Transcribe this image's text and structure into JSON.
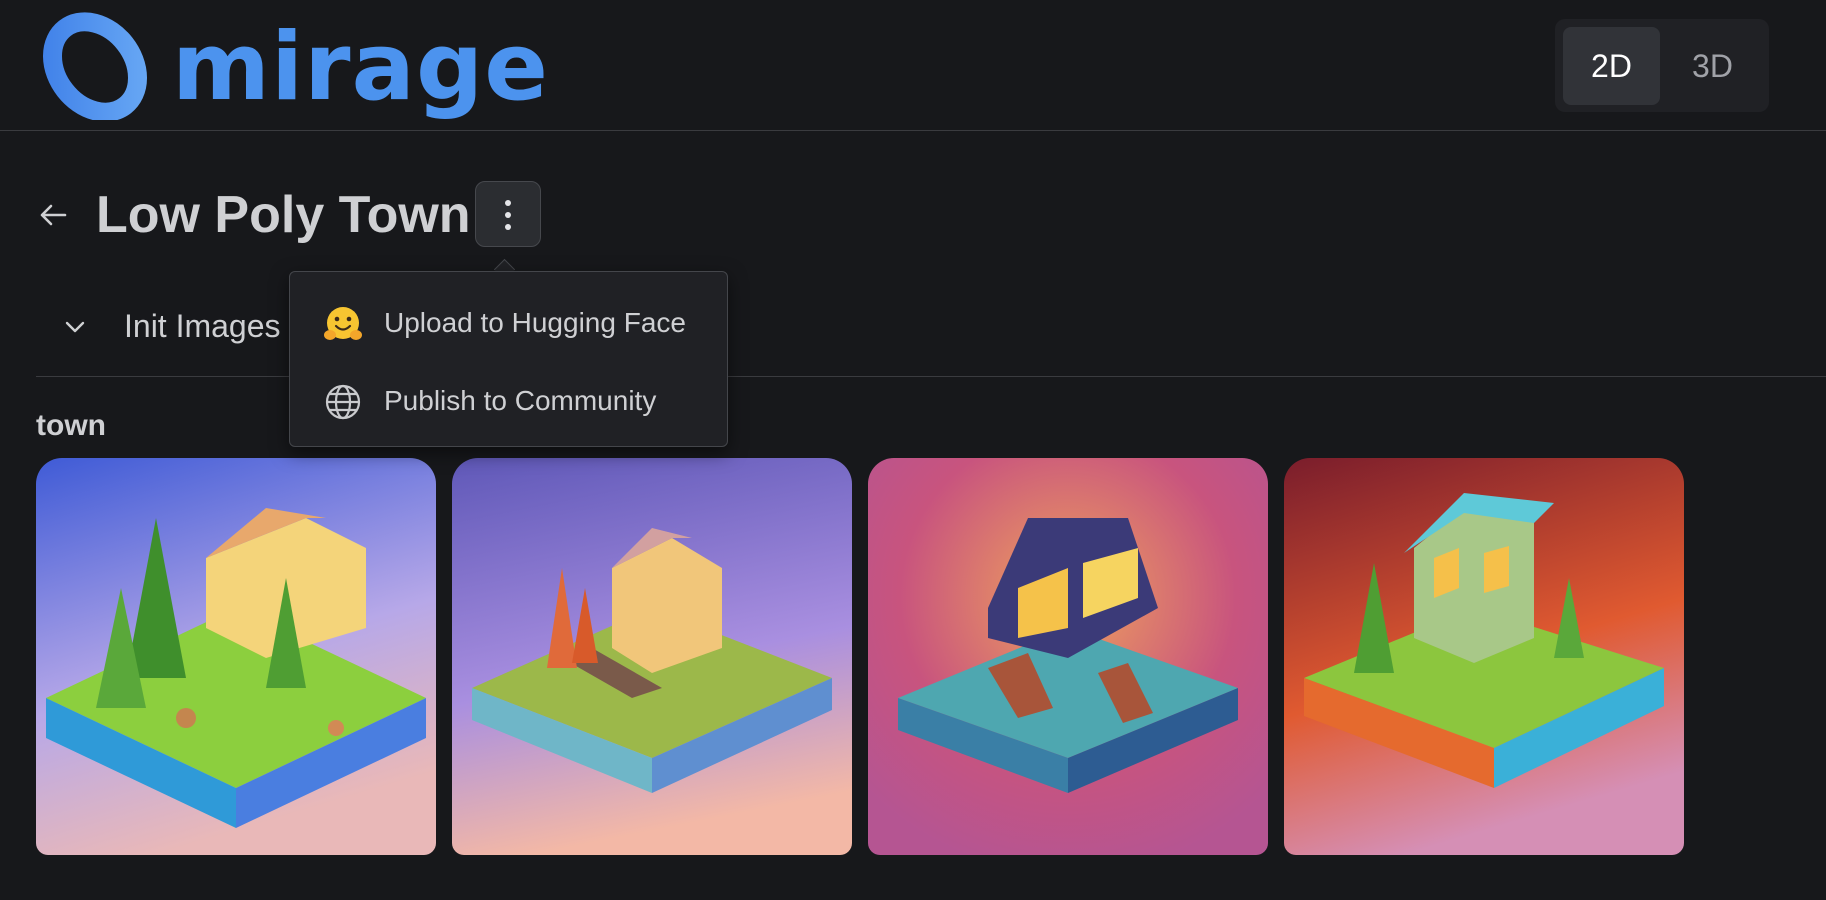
{
  "app": {
    "name": "mirage",
    "brand_color": "#4c93ee"
  },
  "header": {
    "mode_options": [
      "2D",
      "3D"
    ],
    "active_mode": "2D"
  },
  "project": {
    "title": "Low Poly Town"
  },
  "more_menu": {
    "items": [
      {
        "icon": "hugging-face-icon",
        "label": "Upload to Hugging Face"
      },
      {
        "icon": "globe-icon",
        "label": "Publish to Community"
      }
    ]
  },
  "init_section": {
    "label": "Init Images"
  },
  "gallery": {
    "group_title": "town",
    "images": [
      {
        "name": "town-image-1",
        "background": [
          "#3f5bd6",
          "#b7a8e8",
          "#e9b8b8"
        ]
      },
      {
        "name": "town-image-2",
        "background": [
          "#5f58b8",
          "#a98fe0",
          "#f3b8a6"
        ]
      },
      {
        "name": "town-image-3",
        "background": [
          "#c8547e",
          "#f0a35c",
          "#b55592"
        ]
      },
      {
        "name": "town-image-4",
        "background": [
          "#7a1d2c",
          "#e05a30",
          "#d58fb5"
        ]
      }
    ]
  }
}
